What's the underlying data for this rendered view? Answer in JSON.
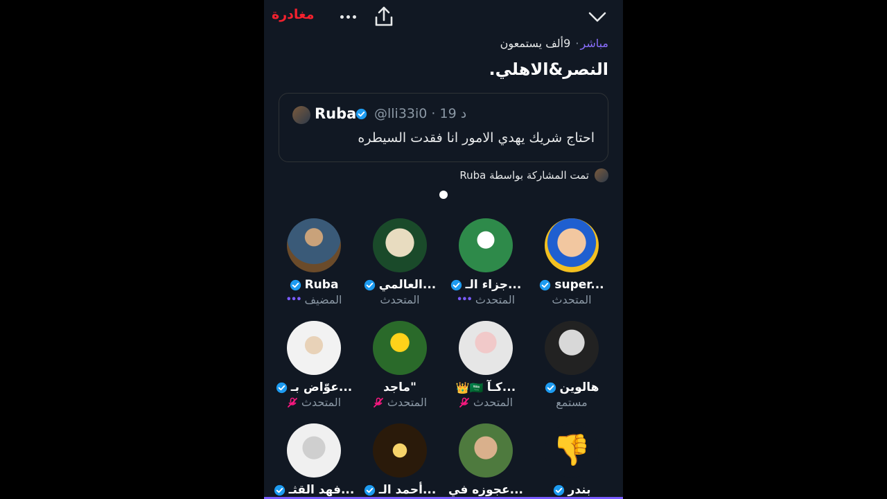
{
  "topbar": {
    "leave_label": "مغادرة",
    "more_icon": "more-horizontal-icon",
    "share_icon": "share-icon",
    "collapse_icon": "chevron-down-icon"
  },
  "space": {
    "live_label": "مباشر",
    "listeners_label": "9ألف يستمعون",
    "title": "النصر&الاهلي."
  },
  "pinned_tweet": {
    "author_name": "Ruba",
    "handle_time": "@lli33i0 · 19 د",
    "text": "احتاج شريك يهدي الامور انا فقدت السيطره"
  },
  "shared_by": "تمت المشاركة بواسطة Ruba",
  "participants": [
    {
      "name": "Ruba",
      "role": "المضيف",
      "verified": true,
      "talking": true,
      "mic_off": false,
      "extra": ""
    },
    {
      "name": "العالمي...",
      "role": "المتحدث",
      "verified": true,
      "talking": false,
      "mic_off": false,
      "extra": ""
    },
    {
      "name": "جزاء الـ...",
      "role": "المتحدث",
      "verified": true,
      "talking": true,
      "mic_off": false,
      "extra": ""
    },
    {
      "name": "super...",
      "role": "المتحدث",
      "verified": true,
      "talking": false,
      "mic_off": false,
      "extra": ""
    },
    {
      "name": "عوّاض بـ...",
      "role": "المتحدث",
      "verified": true,
      "talking": false,
      "mic_off": true,
      "extra": ""
    },
    {
      "name": "ماجد\"",
      "role": "المتحدث",
      "verified": false,
      "talking": false,
      "mic_off": true,
      "extra": ""
    },
    {
      "name": "كـآ...",
      "role": "المتحدث",
      "verified": false,
      "talking": false,
      "mic_off": true,
      "extra": "👑🇸🇦"
    },
    {
      "name": "هالوين",
      "role": "مستمع",
      "verified": true,
      "talking": false,
      "mic_off": false,
      "extra": ""
    },
    {
      "name": "فهد القثـ...",
      "role": "",
      "verified": true,
      "talking": false,
      "mic_off": false,
      "extra": ""
    },
    {
      "name": "أحمد الـ...",
      "role": "",
      "verified": true,
      "talking": false,
      "mic_off": false,
      "extra": ""
    },
    {
      "name": "عجوزه في...",
      "role": "",
      "verified": false,
      "talking": false,
      "mic_off": false,
      "extra": ""
    },
    {
      "name": "بندر",
      "role": "",
      "verified": true,
      "talking": false,
      "mic_off": false,
      "extra": "👎"
    }
  ],
  "colors": {
    "background": "#111823",
    "leave": "#f4212e",
    "live": "#8b6fff",
    "verified": "#1d9bf0",
    "secondary_text": "#8b98a5",
    "mic_off": "#f91880"
  }
}
